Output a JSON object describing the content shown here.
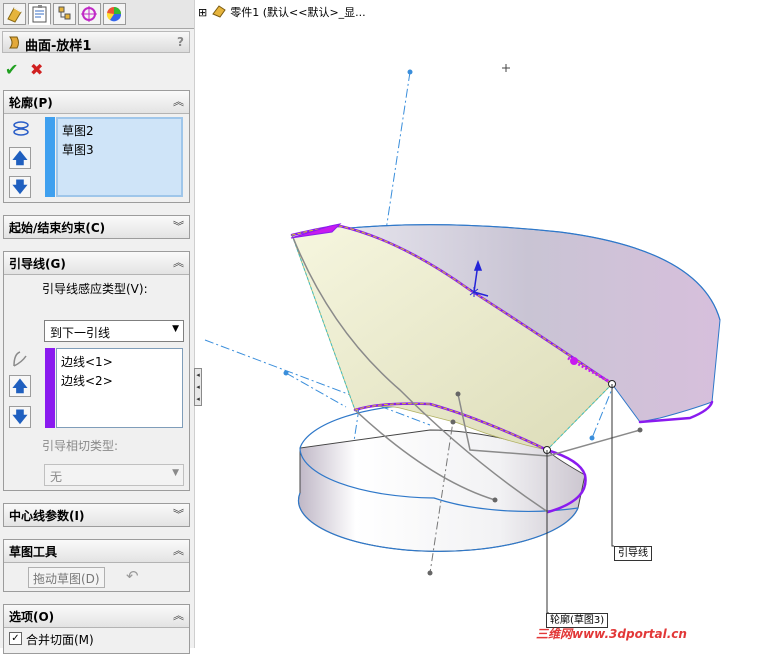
{
  "tabs": [
    {
      "icon": "feature-manager-icon"
    },
    {
      "icon": "property-manager-icon"
    },
    {
      "icon": "configuration-manager-icon"
    },
    {
      "icon": "dimxpert-icon"
    },
    {
      "icon": "display-manager-icon"
    }
  ],
  "feature": {
    "title": "曲面-放样1",
    "help": "?"
  },
  "profiles": {
    "header": "轮廓(P)",
    "items": [
      "草图2",
      "草图3"
    ]
  },
  "start_end": {
    "header": "起始/结束约束(C)"
  },
  "guides": {
    "header": "引导线(G)",
    "influence_label": "引导线感应类型(V):",
    "influence_value": "到下一引线",
    "items": [
      "边线<1>",
      "边线<2>"
    ],
    "tangency_label": "引导相切类型:",
    "tangency_value": "无"
  },
  "centerline": {
    "header": "中心线参数(I)"
  },
  "sketch_tools": {
    "header": "草图工具",
    "drag_label": "拖动草图(D)"
  },
  "options": {
    "header": "选项(O)",
    "merge_label": "合并切面(M)",
    "merge_checked": true
  },
  "tree": {
    "expander": "⊞",
    "label": "零件1 (默认<<默认>_显..."
  },
  "callouts": {
    "guide": "引导线",
    "profile": "轮廓(草图3)"
  },
  "watermark": "三维网www.3dportal.cn",
  "colors": {
    "profile_bar": "#3fa0ef",
    "guide_bar": "#8a1bef",
    "selection": "#c71aef",
    "ok": "#20a020",
    "cancel": "#d02020"
  }
}
